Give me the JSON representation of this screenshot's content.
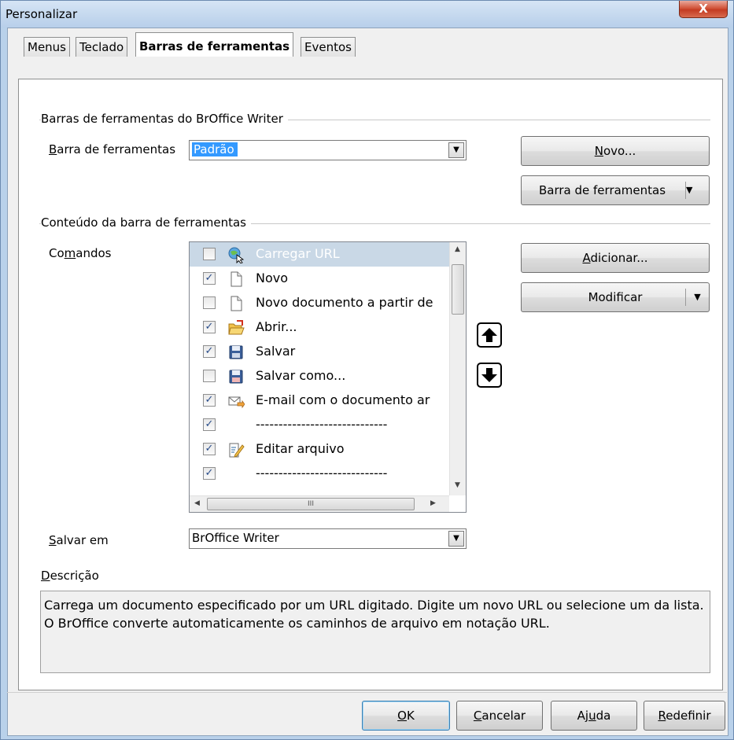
{
  "window": {
    "title": "Personalizar",
    "close_label": "X"
  },
  "tabs": [
    {
      "label": "Menus"
    },
    {
      "label": "Teclado"
    },
    {
      "label": "Barras de ferramentas"
    },
    {
      "label": "Eventos"
    }
  ],
  "group_toolbars": {
    "title": "Barras de ferramentas do BrOffice Writer",
    "toolbar_label_hotkey": "B",
    "toolbar_label_rest": "arra de ferramentas",
    "toolbar_value": "Padrão",
    "new_button_hotkey": "N",
    "new_button_rest": "ovo...",
    "toolbar_menu_button": "Barra de ferramentas"
  },
  "group_content": {
    "title": "Conteúdo da barra de ferramentas",
    "commands_label_pre": "Co",
    "commands_label_hotkey": "m",
    "commands_label_post": "andos",
    "commands": [
      {
        "label": "Carregar URL",
        "checked": false,
        "icon": "globe-cursor-icon"
      },
      {
        "label": "Novo",
        "checked": true,
        "icon": "new-document-icon"
      },
      {
        "label": "Novo documento a partir de",
        "checked": false,
        "icon": "new-document-icon"
      },
      {
        "label": "Abrir...",
        "checked": true,
        "icon": "open-folder-icon"
      },
      {
        "label": "Salvar",
        "checked": true,
        "icon": "save-disk-icon"
      },
      {
        "label": "Salvar como...",
        "checked": false,
        "icon": "save-as-icon"
      },
      {
        "label": "E-mail com o documento ar",
        "checked": true,
        "icon": "email-icon"
      },
      {
        "label": "-----------------------------",
        "checked": true,
        "icon": ""
      },
      {
        "label": "Editar arquivo",
        "checked": true,
        "icon": "edit-file-icon"
      },
      {
        "label": "-----------------------------",
        "checked": true,
        "icon": ""
      }
    ],
    "add_button_hotkey": "A",
    "add_button_rest": "dicionar...",
    "modify_button": "Modificar",
    "hscroll_grip": "III"
  },
  "save_in": {
    "label_hotkey": "S",
    "label_rest": "alvar em",
    "value": "BrOffice Writer"
  },
  "description": {
    "label_hotkey": "D",
    "label_rest": "escrição",
    "text": "Carrega um documento especificado por um URL digitado. Digite um novo URL ou selecione um da lista. O BrOffice converte automaticamente os caminhos de arquivo em notação URL."
  },
  "footer": {
    "ok_hotkey": "O",
    "ok_rest": "K",
    "cancel_hotkey": "C",
    "cancel_rest": "ancelar",
    "help_pre": "Aj",
    "help_hotkey": "u",
    "help_post": "da",
    "reset_hotkey": "R",
    "reset_rest": "edefinir"
  }
}
